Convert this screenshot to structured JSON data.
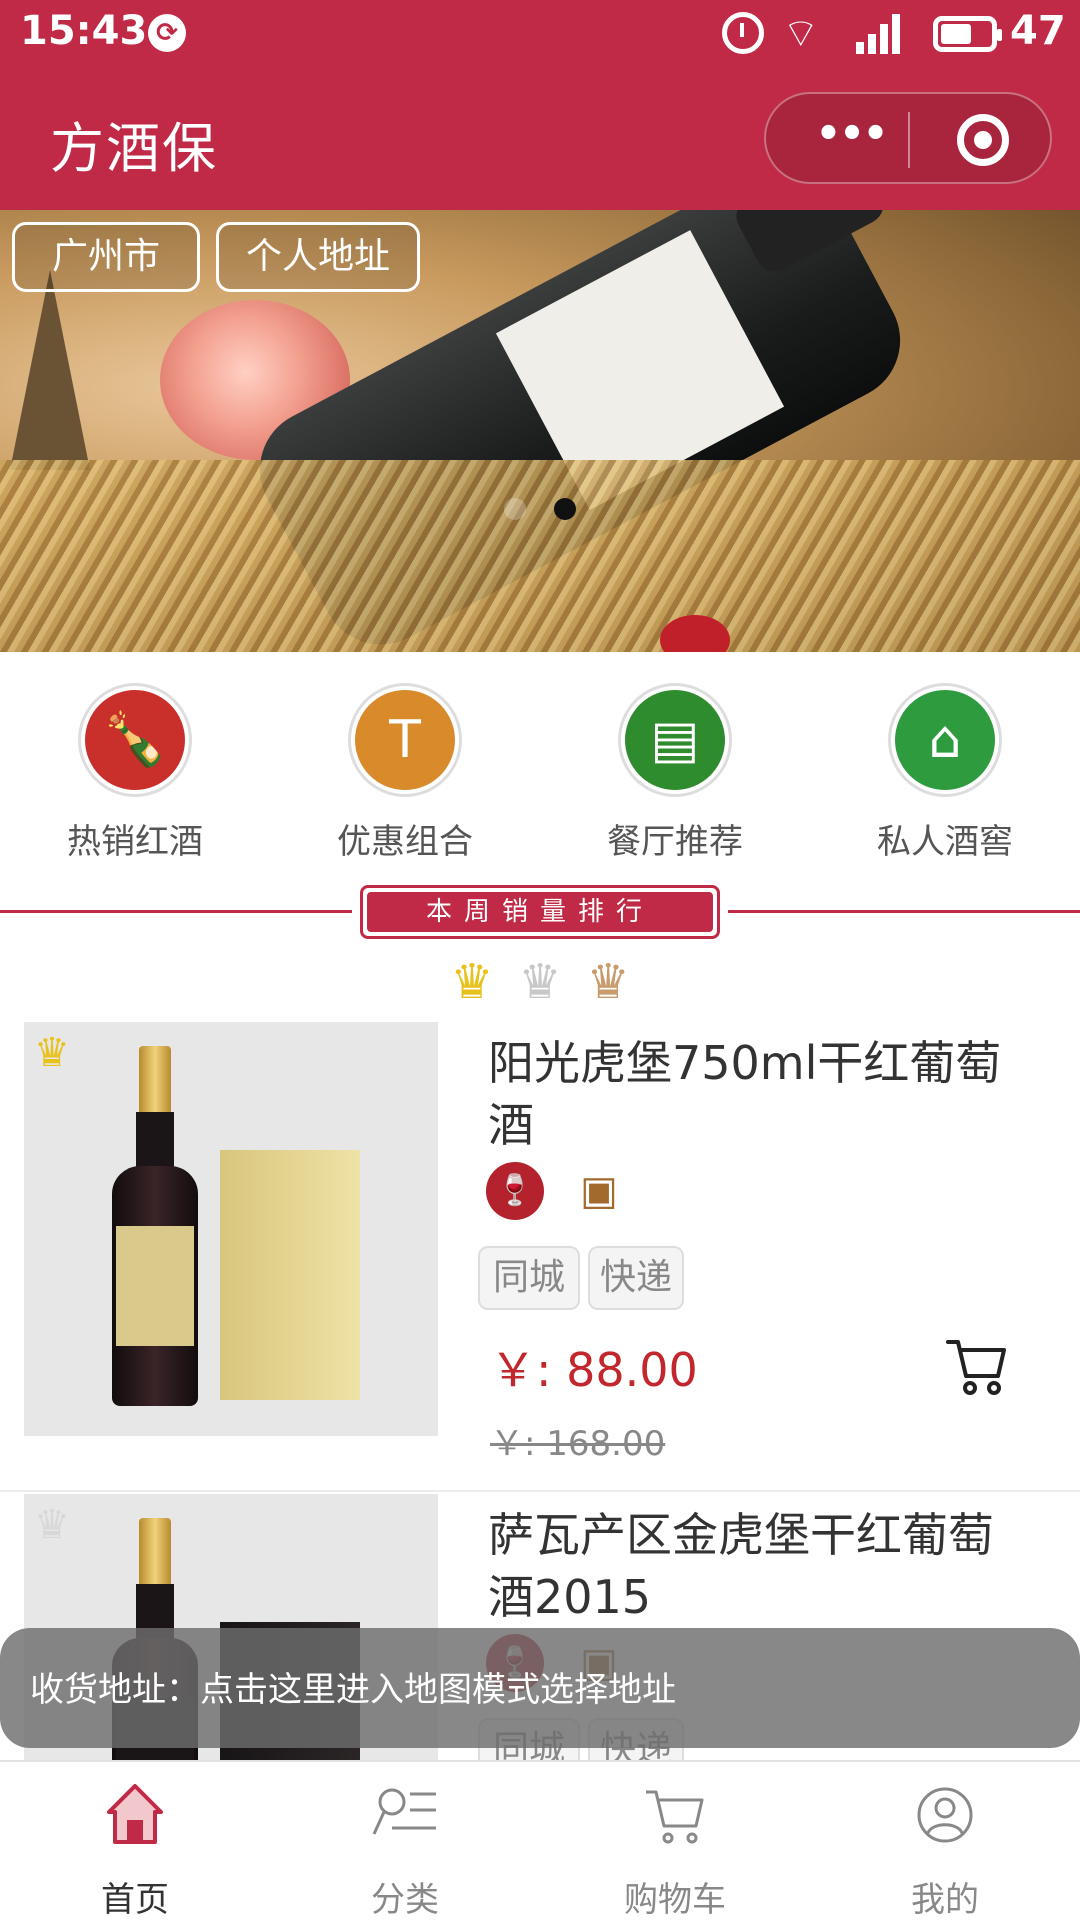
{
  "status_bar": {
    "time": "15:43",
    "battery": "47",
    "network": "4G"
  },
  "nav": {
    "title": "方酒保",
    "more_label": "•••"
  },
  "banner": {
    "city": "广州市",
    "address_button": "个人地址",
    "slides": 2,
    "active_slide": 2
  },
  "categories": [
    {
      "label": "热销红酒",
      "icon": "wine-bottle-icon",
      "color": "#c9302c",
      "glyph": "🍷"
    },
    {
      "label": "优惠组合",
      "icon": "corkscrew-icon",
      "color": "#d98b2b",
      "glyph": "T"
    },
    {
      "label": "餐厅推荐",
      "icon": "menu-waiter-icon",
      "color": "#2e8b2e",
      "glyph": "☗"
    },
    {
      "label": "私人酒窖",
      "icon": "wine-cellar-icon",
      "color": "#2e9b3e",
      "glyph": "⌂"
    }
  ],
  "ranking": {
    "title": "本周销量排行",
    "crowns": [
      "gold-crown-icon",
      "silver-crown-icon",
      "bronze-crown-icon"
    ]
  },
  "products": [
    {
      "name": "阳光虎堡750ml干红葡萄酒",
      "tags": [
        "同城",
        "快递"
      ],
      "price": "￥: 88.00",
      "original_price": "￥: 168.00",
      "crown": "gold-crown-icon"
    },
    {
      "name": "萨瓦产区金虎堡干红葡萄酒2015",
      "tags": [
        "同城",
        "快递"
      ],
      "crown": "silver-crown-icon"
    }
  ],
  "toast": {
    "text": "收货地址：点击这里进入地图模式选择地址"
  },
  "tabbar": [
    {
      "label": "首页",
      "icon": "home-icon",
      "active": true
    },
    {
      "label": "分类",
      "icon": "category-icon",
      "active": false
    },
    {
      "label": "购物车",
      "icon": "cart-icon",
      "active": false
    },
    {
      "label": "我的",
      "icon": "user-icon",
      "active": false
    }
  ],
  "colors": {
    "brand": "#c12a46",
    "price": "#c1272d",
    "gold": "#e8c21c",
    "silver": "#c8c8c8",
    "bronze": "#c79b6c"
  }
}
